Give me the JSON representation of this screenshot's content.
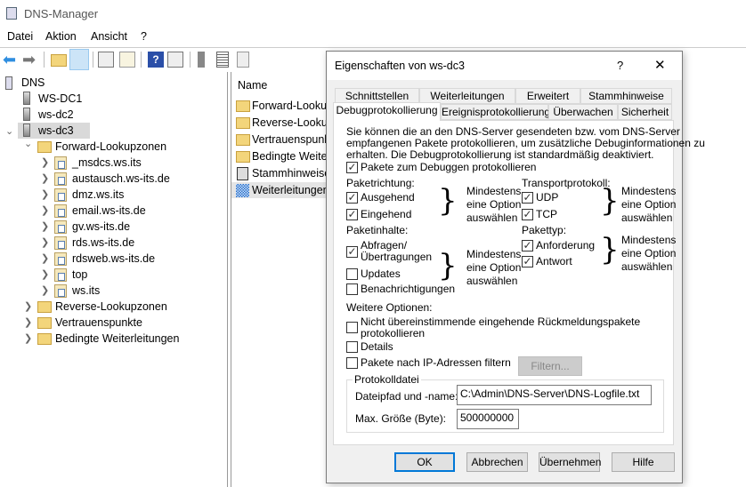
{
  "app": {
    "title": "DNS-Manager"
  },
  "menu": [
    "Datei",
    "Aktion",
    "Ansicht",
    "?"
  ],
  "toolbar": {
    "icons": [
      "back-arrow-icon",
      "forward-arrow-icon",
      "up-folder-icon",
      "show-hide-tree-icon",
      "properties-icon",
      "export-list-icon",
      "help-icon",
      "show-action-pane-icon",
      "server-icon",
      "list-icon",
      "copy-icon"
    ]
  },
  "tree": {
    "root": "DNS",
    "servers": [
      "WS-DC1",
      "ws-dc2",
      "ws-dc3"
    ],
    "forward": "Forward-Lookupzonen",
    "zones": [
      "_msdcs.ws.its",
      "austausch.ws-its.de",
      "dmz.ws.its",
      "email.ws-its.de",
      "gv.ws-its.de",
      "rds.ws-its.de",
      "rdsweb.ws-its.de",
      "top",
      "ws.its"
    ],
    "others": [
      "Reverse-Lookupzonen",
      "Vertrauenspunkte",
      "Bedingte Weiterleitungen"
    ]
  },
  "list": {
    "header": "Name",
    "items": [
      "Forward-Lookup",
      "Reverse-Lookup",
      "Vertrauenspunkt",
      "Bedingte Weiter",
      "Stammhinweise",
      "Weiterleitungen"
    ]
  },
  "dialog": {
    "title": "Eigenschaften von ws-dc3",
    "help": "?",
    "close": "✕",
    "tabs_row1": [
      "Schnittstellen",
      "Weiterleitungen",
      "Erweitert",
      "Stammhinweise"
    ],
    "tabs_row2": [
      "Debugprotokollierung",
      "Ereignisprotokollierung",
      "Überwachen",
      "Sicherheit"
    ],
    "active_tab": "Debugprotokollierung",
    "description": [
      "Sie können die an den DNS-Server gesendeten bzw. vom DNS-Server",
      "empfangenen Pakete protokollieren, um zusätzliche Debuginformationen zu",
      "erhalten. Die Debugprotokollierung ist standardmäßig deaktiviert."
    ],
    "log_packets": {
      "label": "Pakete zum Debuggen protokollieren",
      "checked": true
    },
    "note": [
      "Mindestens",
      "eine Option",
      "auswählen"
    ],
    "direction": {
      "label": "Paketrichtung:",
      "options": [
        {
          "label": "Ausgehend",
          "checked": true
        },
        {
          "label": "Eingehend",
          "checked": true
        }
      ]
    },
    "transport": {
      "label": "Transportprotokoll:",
      "options": [
        {
          "label": "UDP",
          "checked": true
        },
        {
          "label": "TCP",
          "checked": true
        }
      ]
    },
    "contents": {
      "label": "Paketinhalte:",
      "options": [
        {
          "label1": "Abfragen/",
          "label2": "Übertragungen",
          "checked": true
        },
        {
          "label": "Updates",
          "checked": false
        },
        {
          "label": "Benachrichtigungen",
          "checked": false
        }
      ]
    },
    "type": {
      "label": "Pakettyp:",
      "options": [
        {
          "label": "Anforderung",
          "checked": true
        },
        {
          "label": "Antwort",
          "checked": true
        }
      ]
    },
    "more": {
      "label": "Weitere Optionen:",
      "unmatched1": "Nicht übereinstimmende eingehende Rückmeldungspakete",
      "unmatched2": "protokollieren",
      "details": "Details",
      "filter_ip": "Pakete nach IP-Adressen filtern",
      "filter_button": "Filtern..."
    },
    "logfile": {
      "group": "Protokolldatei",
      "path_label": "Dateipfad und -name:",
      "path": "C:\\Admin\\DNS-Server\\DNS-Logfile.txt",
      "size_label": "Max. Größe (Byte):",
      "size": "500000000"
    },
    "buttons": {
      "ok": "OK",
      "cancel": "Abbrechen",
      "apply": "Übernehmen",
      "help": "Hilfe"
    }
  }
}
